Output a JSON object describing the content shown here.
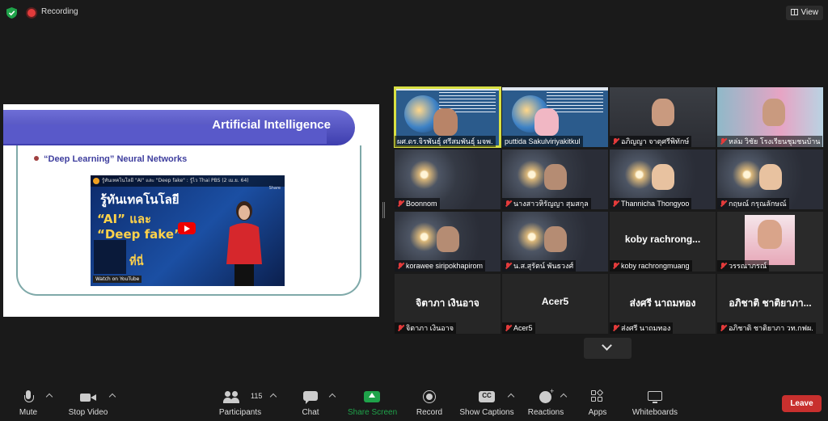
{
  "recording": {
    "label": "Recording"
  },
  "view_button": {
    "label": "View"
  },
  "shared_slide": {
    "title": "Artificial Intelligence",
    "bullet": "“Deep Learning” Neural Networks",
    "video": {
      "caption": "รู้ทันเทคโนโลยี \"AI\" และ \"Deep fake\" : รู้ไว Thai PBS (2 เม.ย. 64)",
      "headline_1": "รู้ทันเทคโนโลยี",
      "headline_2": "“AI” และ",
      "headline_3": "“Deep fake”",
      "overlay_thai": "ที่นี่",
      "watch_on": "Watch on YouTube",
      "share": "Share"
    }
  },
  "participants": [
    {
      "name": "ผศ.ดร.จิรพันธุ์ ศรีสมพันธุ์ มจพ.",
      "muted": false,
      "active": true,
      "type": "slide"
    },
    {
      "name": "puttida Sakulviriyakitkul",
      "muted": false,
      "active": false,
      "type": "slide"
    },
    {
      "name": "อภิญญา จาตุศรีพิทักษ์",
      "muted": true,
      "active": false,
      "type": "video"
    },
    {
      "name": "หล่ม วิชัย โรงเรียนชุมชนบ้าน",
      "muted": true,
      "active": false,
      "type": "video"
    },
    {
      "name": "Boonnom",
      "muted": true,
      "active": false,
      "type": "bg"
    },
    {
      "name": "นางสาวหิรัญญา สุมสกุล",
      "muted": true,
      "active": false,
      "type": "bg"
    },
    {
      "name": "Thannicha Thongyoo",
      "muted": true,
      "active": false,
      "type": "bg"
    },
    {
      "name": "กฤษณ์ กรุณลักษณ์",
      "muted": true,
      "active": false,
      "type": "bg"
    },
    {
      "name": "korawee siripokhapirom",
      "muted": true,
      "active": false,
      "type": "bg"
    },
    {
      "name": "น.ส.สุรัตน์ พันธวงศ์",
      "muted": true,
      "active": false,
      "type": "bg"
    },
    {
      "name": "koby rachrongmuang",
      "muted": true,
      "active": false,
      "type": "dark",
      "display": "koby rachrong..."
    },
    {
      "name": "วรรณาภรณ์",
      "muted": true,
      "active": false,
      "type": "photo"
    },
    {
      "name": "จิตาภา เงินอาจ",
      "muted": true,
      "active": false,
      "type": "dark",
      "display": "จิตาภา เงินอาจ"
    },
    {
      "name": "Acer5",
      "muted": true,
      "active": false,
      "type": "dark",
      "display": "Acer5"
    },
    {
      "name": "ส่งศรี นาถมทอง",
      "muted": true,
      "active": false,
      "type": "dark",
      "display": "ส่งศรี นาถมทอง"
    },
    {
      "name": "อภิชาติ ชาติยาภา วท.กฟผ.",
      "muted": true,
      "active": false,
      "type": "dark",
      "display": "อภิชาติ ชาติยาภา..."
    }
  ],
  "toolbar": {
    "mute": "Mute",
    "stop_video": "Stop Video",
    "participants": "Participants",
    "participant_count": "115",
    "chat": "Chat",
    "share_screen": "Share Screen",
    "record": "Record",
    "show_captions": "Show Captions",
    "cc": "CC",
    "reactions": "Reactions",
    "apps": "Apps",
    "whiteboards": "Whiteboards",
    "leave": "Leave"
  },
  "colors": {
    "share_screen": "#1fa34a",
    "leave": "#c8302e",
    "active_speaker": "#d8e043",
    "muted_mic": "#e43b3b"
  }
}
